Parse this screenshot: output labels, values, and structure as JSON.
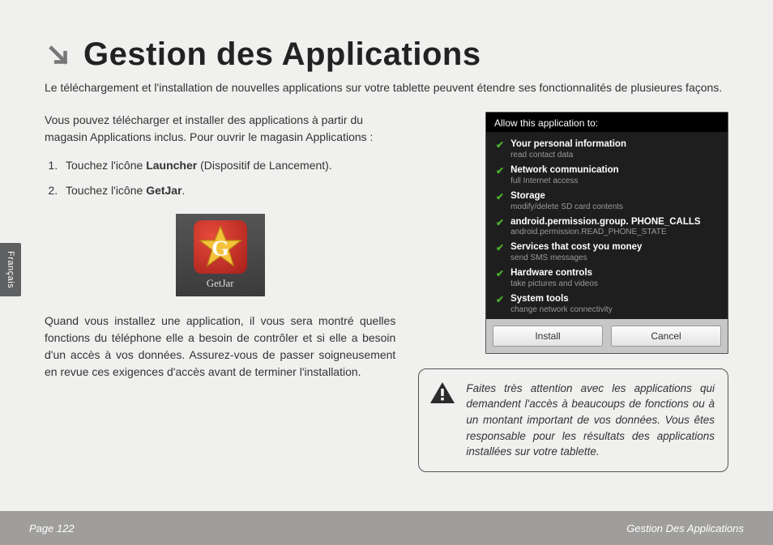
{
  "title": "Gestion des Applications",
  "intro": "Le téléchargement et l'installation de nouvelles applications sur votre tablette peuvent étendre ses fonctionnalités de plusieures façons.",
  "left": {
    "para1": "Vous pouvez télécharger et installer des applications à partir du magasin Applications inclus. Pour ouvrir le magasin Applications :",
    "step1_pre": "Touchez l'icône ",
    "step1_bold": "Launcher",
    "step1_post": " (Dispositif de Lancement).",
    "step2_pre": "Touchez l'icône ",
    "step2_bold": "GetJar",
    "step2_post": ".",
    "getjar_label": "GetJar",
    "para2": "Quand vous installez une application, il vous sera montré quelles fonctions du téléphone elle a besoin de contrôler et si elle a besoin d'un accès à vos données. Assurez-vous de passer soigneusement en revue ces exigences d'accès avant de terminer l'installation."
  },
  "dialog": {
    "header": "Allow this application to:",
    "perms": [
      {
        "title": "Your personal information",
        "sub": "read contact data"
      },
      {
        "title": "Network communication",
        "sub": "full Internet access"
      },
      {
        "title": "Storage",
        "sub": "modify/delete SD card contents"
      },
      {
        "title": "android.permission.group. PHONE_CALLS",
        "sub": "android.permission.READ_PHONE_STATE"
      },
      {
        "title": "Services that cost you money",
        "sub": "send SMS messages"
      },
      {
        "title": "Hardware controls",
        "sub": "take pictures and videos"
      },
      {
        "title": "System tools",
        "sub": "change network connectivity"
      }
    ],
    "install": "Install",
    "cancel": "Cancel"
  },
  "warning": "Faites très attention avec les applications qui demandent l'accès à beaucoups de fonctions ou à un montant important de vos données. Vous êtes responsable pour les résultats des applications installées sur votre tablette.",
  "lang_tab": "Français",
  "footer": {
    "left": "Page 122",
    "right": "Gestion Des Applications"
  }
}
